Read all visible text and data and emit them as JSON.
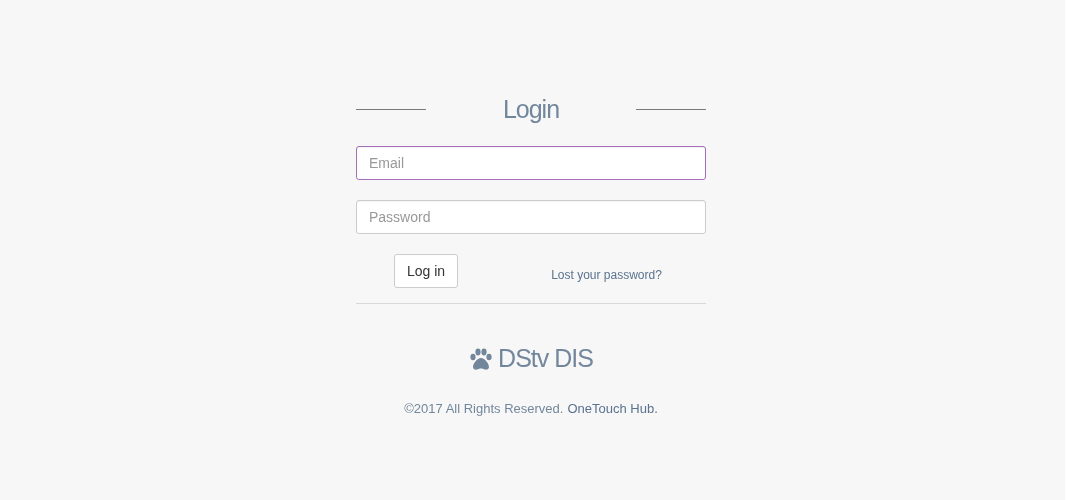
{
  "title": "Login",
  "fields": [
    {
      "placeholder": "Email",
      "focused": true
    },
    {
      "placeholder": "Password",
      "focused": false
    }
  ],
  "login_button": "Log in",
  "lost_password_link": "Lost your password?",
  "brand": "DStv DIS",
  "footer": {
    "text": "©2017 All Rights Reserved.",
    "link": "OneTouch Hub."
  }
}
